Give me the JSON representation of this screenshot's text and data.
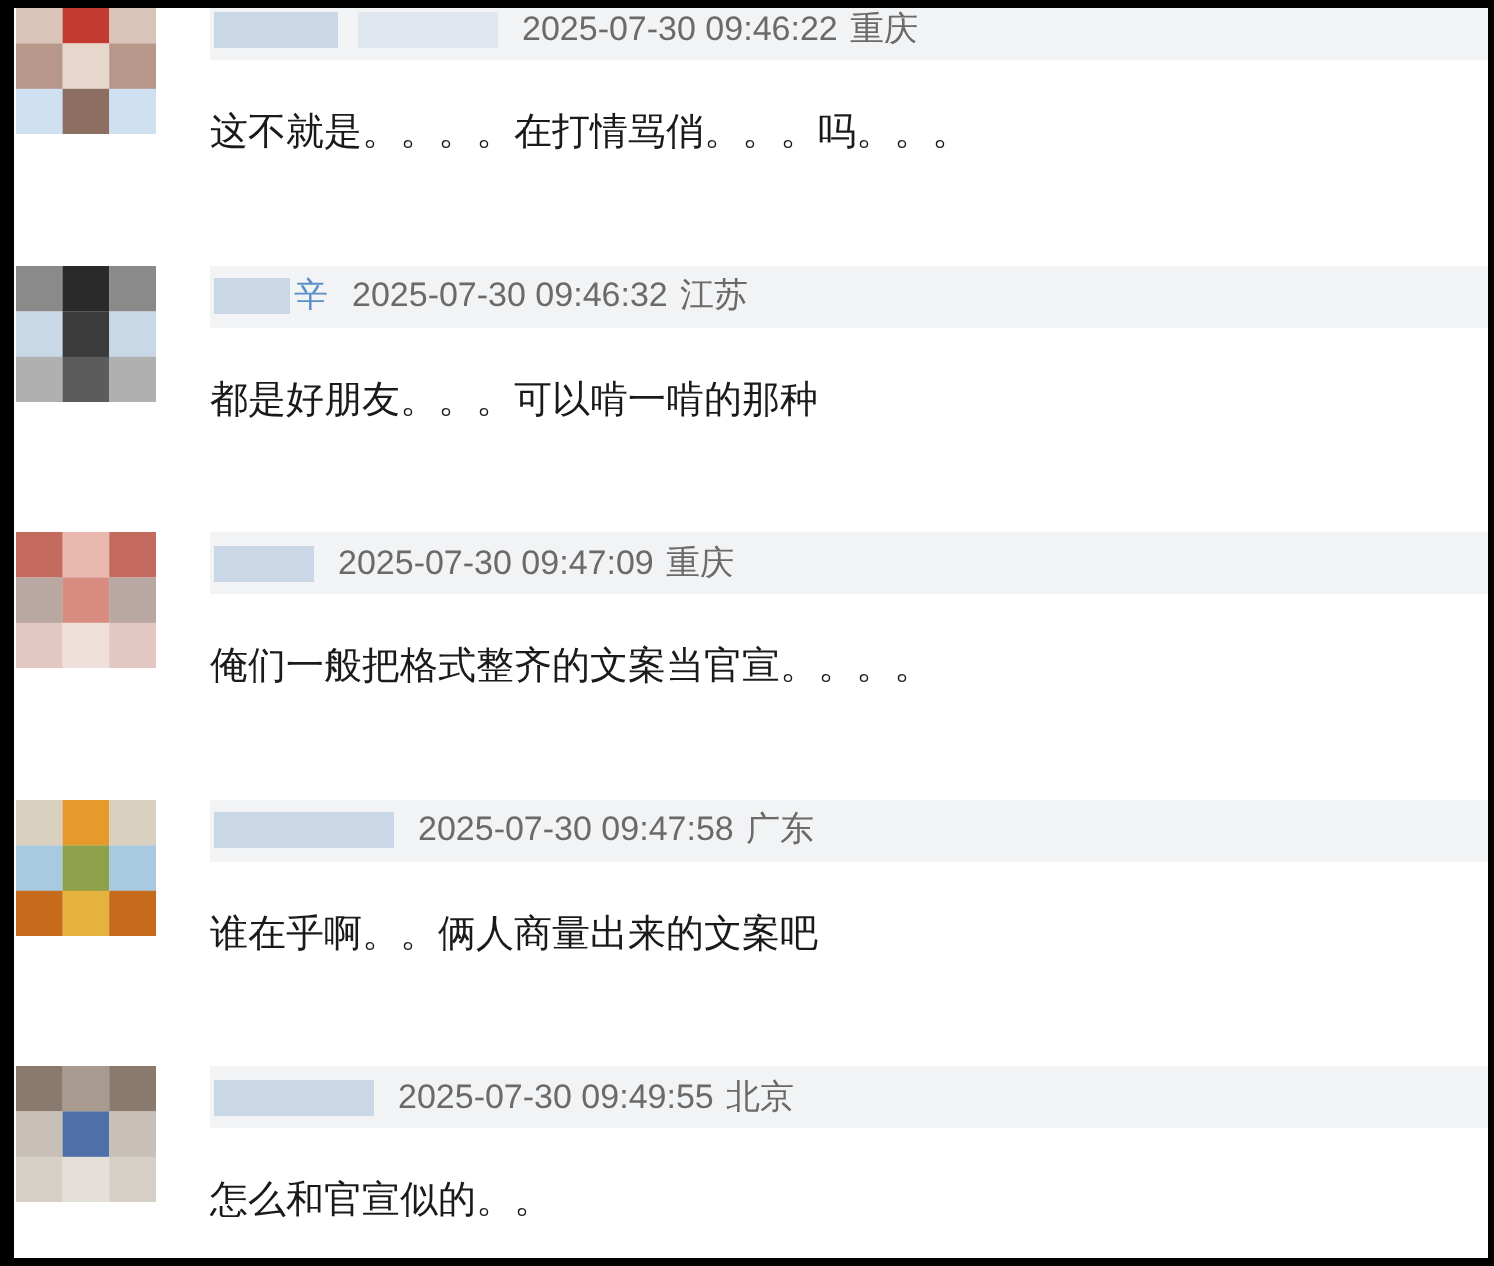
{
  "comments": [
    {
      "time": "2025-07-30 09:46:22",
      "location": "重庆",
      "text": "这不就是。。。。在打情骂俏。。。吗。。。"
    },
    {
      "name_tail": "辛",
      "time": "2025-07-30 09:46:32",
      "location": "江苏",
      "text": "都是好朋友。。。可以啃一啃的那种"
    },
    {
      "time": "2025-07-30 09:47:09",
      "location": "重庆",
      "text": "俺们一般把格式整齐的文案当官宣。。。。"
    },
    {
      "time": "2025-07-30 09:47:58",
      "location": "广东",
      "text": "谁在乎啊。。俩人商量出来的文案吧"
    },
    {
      "time": "2025-07-30 09:49:55",
      "location": "北京",
      "text": "怎么和官宣似的。。"
    }
  ]
}
